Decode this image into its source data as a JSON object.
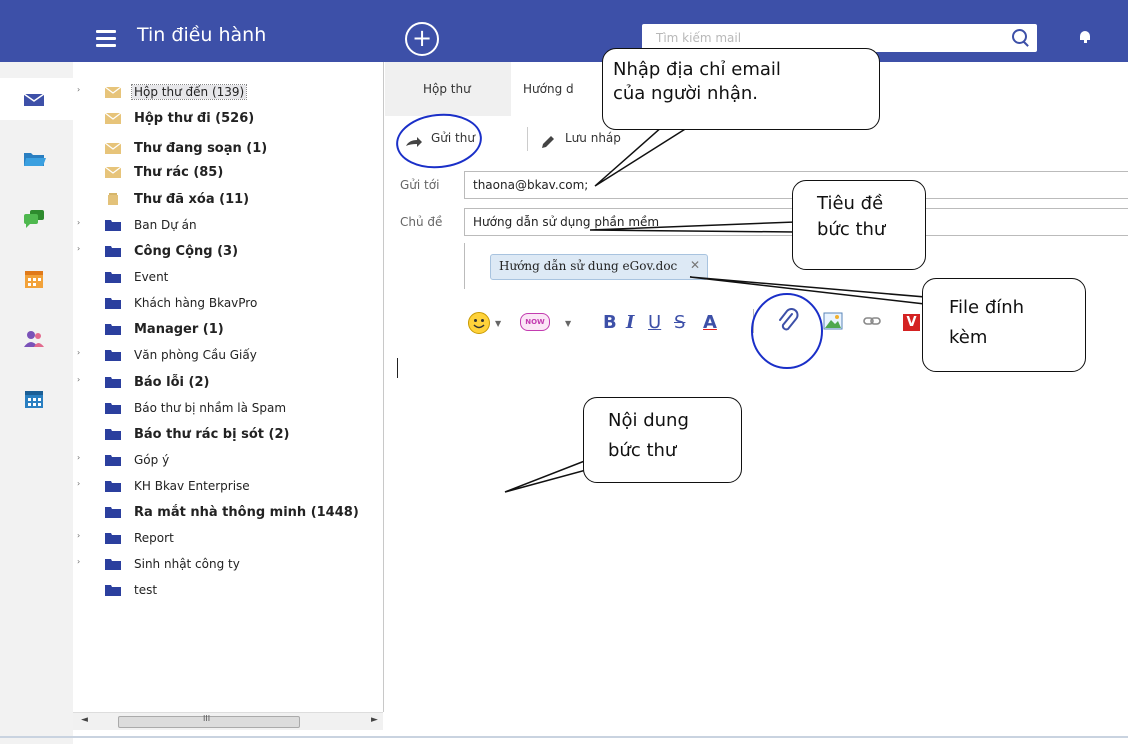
{
  "header": {
    "title": "Tin điều hành",
    "compose_symbol": "+",
    "search_placeholder": "Tìm kiếm mail"
  },
  "rail": [
    "mail-icon",
    "folder-icon",
    "chat-icon",
    "calendar-icon",
    "contacts-icon",
    "tasks-icon"
  ],
  "folders": [
    {
      "label": "Hộp thư đến (139)",
      "icon": "inbox-icon"
    },
    {
      "label": "Hộp thư đi (526)",
      "icon": "outbox-icon"
    },
    {
      "label": "Thư đang soạn (1)",
      "icon": "drafts-icon"
    },
    {
      "label": "Thư rác (85)",
      "icon": "spam-icon"
    },
    {
      "label": "Thư đã xóa (11)",
      "icon": "trash-icon"
    },
    {
      "label": "Ban Dự án",
      "icon": "folder-icon"
    },
    {
      "label": "Công Cộng (3)",
      "icon": "folder-icon"
    },
    {
      "label": "Event",
      "icon": "folder-icon"
    },
    {
      "label": "Khách hàng BkavPro",
      "icon": "folder-icon"
    },
    {
      "label": "Manager (1)",
      "icon": "folder-icon"
    },
    {
      "label": "Văn phòng Cầu Giấy",
      "icon": "folder-icon"
    },
    {
      "label": "Báo lỗi (2)",
      "icon": "folder-icon"
    },
    {
      "label": "Báo thư bị nhầm là Spam",
      "icon": "folder-icon"
    },
    {
      "label": "Báo thư rác bị sót (2)",
      "icon": "folder-icon"
    },
    {
      "label": "Góp ý",
      "icon": "folder-icon"
    },
    {
      "label": "KH Bkav Enterprise",
      "icon": "folder-icon"
    },
    {
      "label": "Ra mắt nhà thông minh (1448)",
      "icon": "folder-icon"
    },
    {
      "label": "Report",
      "icon": "folder-icon"
    },
    {
      "label": "Sinh nhật công ty",
      "icon": "folder-icon"
    },
    {
      "label": "test",
      "icon": "folder-icon"
    }
  ],
  "scrollbar": {
    "thumb_glyph": "III"
  },
  "tabs": {
    "inbox": "Hộp thư",
    "compose": "Hướng d"
  },
  "toolbar": {
    "send": "Gửi thư",
    "save_draft": "Lưu nháp"
  },
  "compose": {
    "to_label": "Gửi tới",
    "to_value": "thaona@bkav.com;",
    "subject_label": "Chủ đề",
    "subject_value": "Hướng dẫn sử dụng phần mềm",
    "attachment": "Hướng dẫn sử dung eGov.doc",
    "attachment_remove": "✕"
  },
  "formatting": {
    "bold": "B",
    "italic": "I",
    "underline": "U",
    "strike": "S",
    "color": "A",
    "now_badge": "NOW",
    "video_badge": "V"
  },
  "callouts": {
    "recipient": [
      "Nhập địa chỉ email",
      "của người nhận."
    ],
    "subject": [
      "Tiêu đề",
      "bức thư"
    ],
    "attachment": [
      "File đính",
      "kèm"
    ],
    "body": [
      "Nội dung",
      "bức thư"
    ]
  },
  "colors": {
    "header_bg": "#3d50a8",
    "chip_bg": "#dde9f5",
    "annotation_circle": "#1a2fc8"
  }
}
